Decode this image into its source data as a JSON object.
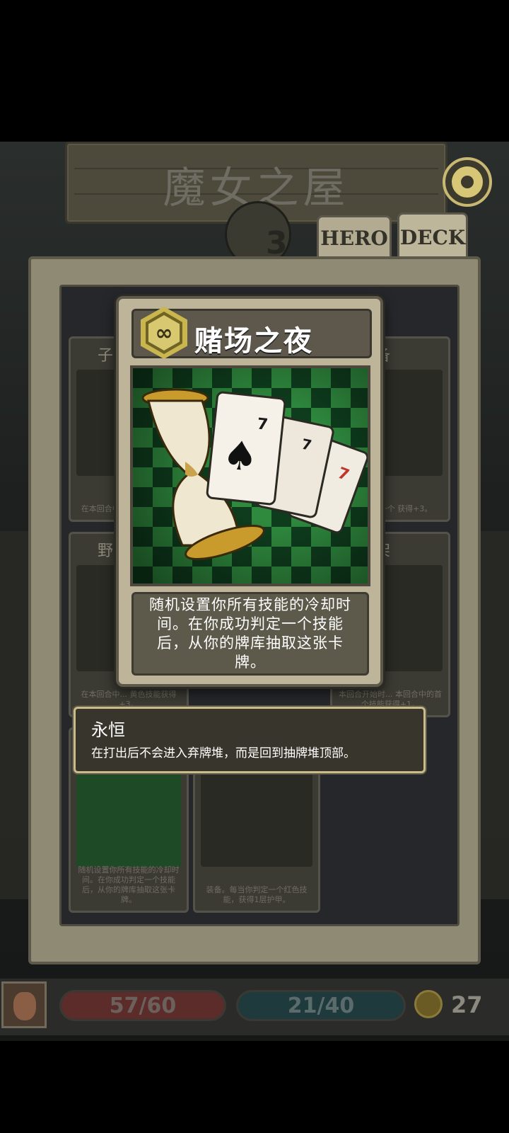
{
  "header": {
    "title": "魔女之屋",
    "level": "3"
  },
  "tabs": [
    {
      "label": "HERO"
    },
    {
      "label": "DECK"
    }
  ],
  "background_cards": [
    {
      "name": "子弹",
      "desc": "在本回合中... 红色技能的..."
    },
    {
      "name": "装备",
      "desc": "使你的下一个 获得+3。"
    },
    {
      "name": "野战",
      "desc": "在本回合中... 黄色技能获得+3。"
    },
    {
      "name": "支架",
      "desc": "本回合开始时... 本回合中的首个技能获得+1。"
    },
    {
      "name": "",
      "desc": "随机设置你所有技能的冷却时间。在你成功判定一个技能后，从你的牌库抽取这张卡牌。"
    },
    {
      "name": "",
      "desc": "装备。每当你判定一个红色技能，获得1层护甲。"
    }
  ],
  "detail_card": {
    "name": "赌场之夜",
    "badge_icon": "infinity",
    "description": "随机设置你所有技能的冷却时间。在你成功判定一个技能后，从你的牌库抽取这张卡牌。",
    "art": {
      "cards": [
        "7",
        "7",
        "7"
      ],
      "colors": {
        "green_dark": "#0e3d1d",
        "green_light": "#2f8a3e"
      }
    }
  },
  "keyword": {
    "title": "永恒",
    "description": "在打出后不会进入弃牌堆，而是回到抽牌堆顶部。"
  },
  "status": {
    "hp": "57/60",
    "energy": "21/40",
    "coins": "27"
  },
  "colors": {
    "hp": "#5b2c2a",
    "energy": "#1f3a3c",
    "gold": "#c9b64f"
  }
}
